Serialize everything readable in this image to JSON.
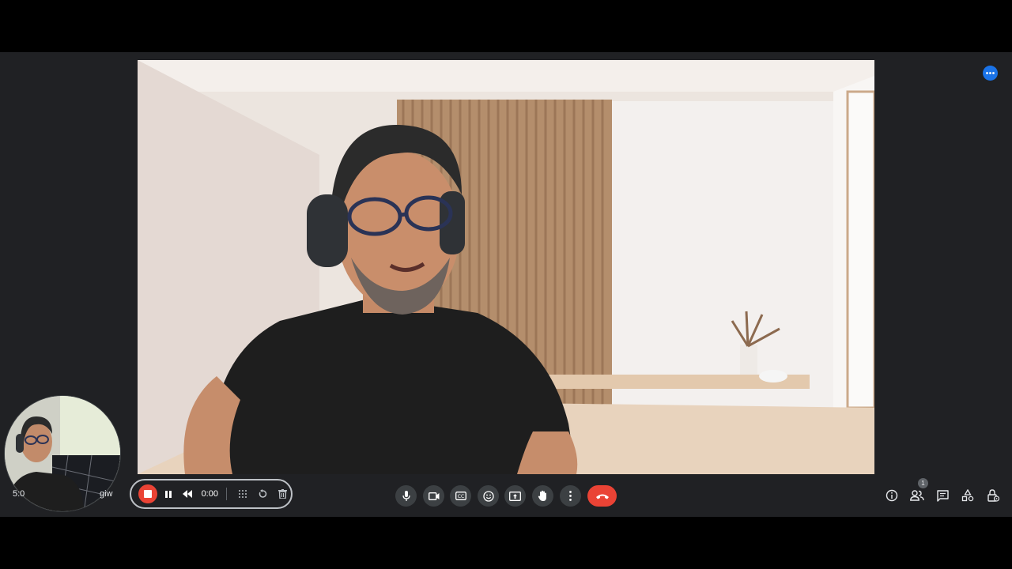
{
  "meeting": {
    "clock": "5:0",
    "code": "giw",
    "more_options_label": "More options"
  },
  "recorder": {
    "elapsed": "0:00"
  },
  "participants": {
    "count": "1"
  },
  "icons": {
    "top_right": "more-horizontal-icon",
    "recorder": [
      "stop-icon",
      "pause-icon",
      "rewind-icon",
      "grid-icon",
      "reset-icon",
      "trash-icon"
    ],
    "center": [
      "microphone-icon",
      "camera-icon",
      "captions-icon",
      "emoji-icon",
      "present-icon",
      "hand-raise-icon",
      "more-vert-icon",
      "hang-up-icon"
    ],
    "right": [
      "info-icon",
      "people-icon",
      "chat-icon",
      "activities-icon",
      "host-controls-icon"
    ]
  },
  "colors": {
    "background": "#202124",
    "control_bg": "#3c4043",
    "end_call": "#ea4335",
    "accent": "#1a73e8"
  }
}
